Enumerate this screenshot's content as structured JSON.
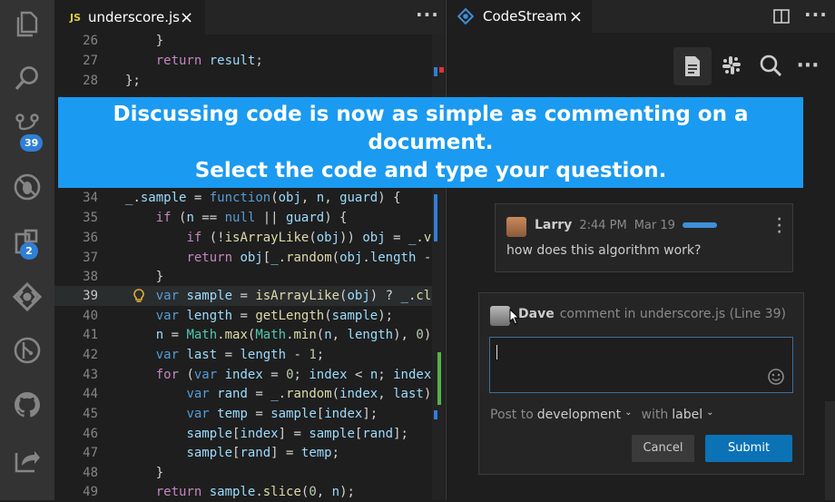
{
  "activity_bar": {
    "icons": [
      "files-icon",
      "search-icon",
      "source-control-icon",
      "debug-icon",
      "extensions-icon",
      "codestream-icon",
      "git-branch-icon",
      "github-icon",
      "live-share-icon"
    ],
    "source_control_badge": "39",
    "extensions_badge": "2"
  },
  "editor": {
    "tab": {
      "badge": "JS",
      "filename": "underscore.js"
    },
    "lines": [
      {
        "n": "26",
        "current": false
      },
      {
        "n": "27",
        "current": false
      },
      {
        "n": "28",
        "current": false
      },
      {
        "n": "34",
        "current": false
      },
      {
        "n": "35",
        "current": false
      },
      {
        "n": "36",
        "current": false
      },
      {
        "n": "37",
        "current": false
      },
      {
        "n": "38",
        "current": false
      },
      {
        "n": "39",
        "current": true
      },
      {
        "n": "40",
        "current": false
      },
      {
        "n": "41",
        "current": false
      },
      {
        "n": "42",
        "current": false
      },
      {
        "n": "43",
        "current": false
      },
      {
        "n": "44",
        "current": false
      },
      {
        "n": "45",
        "current": false
      },
      {
        "n": "46",
        "current": false
      },
      {
        "n": "47",
        "current": false
      },
      {
        "n": "48",
        "current": false
      },
      {
        "n": "49",
        "current": false
      }
    ]
  },
  "banner": {
    "line1": "Discussing code is now as simple as commenting on a document.",
    "line2": "Select the code and type your question."
  },
  "panel": {
    "tab_title": "CodeStream",
    "tools": [
      "document-icon",
      "slack-icon",
      "search-icon",
      "more-icon"
    ],
    "post": {
      "author": "Larry",
      "time": "2:44 PM",
      "date": "Mar 19",
      "text": "how does this algorithm work?"
    },
    "compose": {
      "author": "Dave",
      "context": "comment in underscore.js (Line 39)",
      "input_value": "",
      "post_to_label": "Post to",
      "channel": "development",
      "with_label_prefix": "with",
      "with_label_value": "label",
      "cancel_label": "Cancel",
      "submit_label": "Submit"
    }
  },
  "colors": {
    "banner_bg": "#1a9af0",
    "submit_bg": "#0b72b5",
    "badge_bg": "#2f7fd7",
    "accent_bar": "#3e8fd8"
  }
}
